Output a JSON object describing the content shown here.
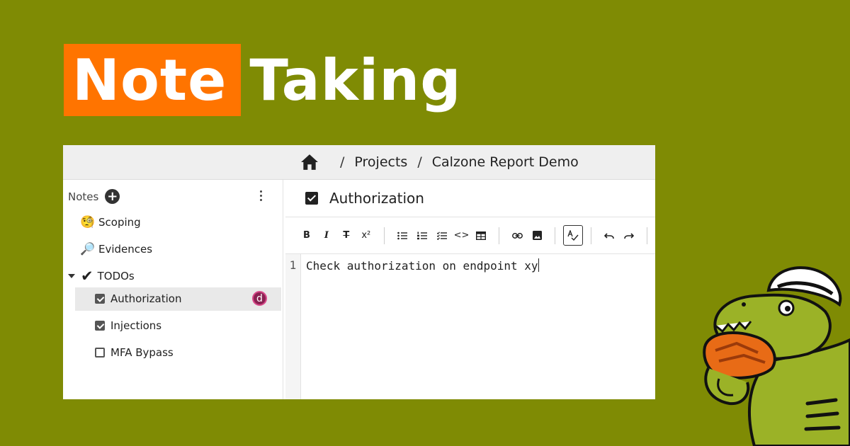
{
  "headline": {
    "highlight": "Note",
    "rest": "Taking"
  },
  "breadcrumb": {
    "items": [
      "Projects",
      "Calzone Report Demo"
    ],
    "separator": "/"
  },
  "sidebar": {
    "header_label": "Notes",
    "items": [
      {
        "label": "Scoping",
        "emoji": "🧐"
      },
      {
        "label": "Evidences",
        "emoji": "🔎"
      },
      {
        "label": "TODOs",
        "emoji": "✔"
      },
      {
        "label": "Authorization",
        "checked": true,
        "selected": true,
        "avatar": "d"
      },
      {
        "label": "Injections",
        "checked": true
      },
      {
        "label": "MFA Bypass",
        "checked": false
      }
    ]
  },
  "note": {
    "title": "Authorization"
  },
  "toolbar": {
    "bold": "B",
    "italic": "I",
    "strike": "T",
    "superscript": "x²",
    "code": "<>"
  },
  "editor": {
    "line_number": "1",
    "content": "Check authorization on endpoint xy"
  },
  "colors": {
    "background": "#7f8b04",
    "accent": "#ff7400",
    "avatar": "#8a2252"
  }
}
